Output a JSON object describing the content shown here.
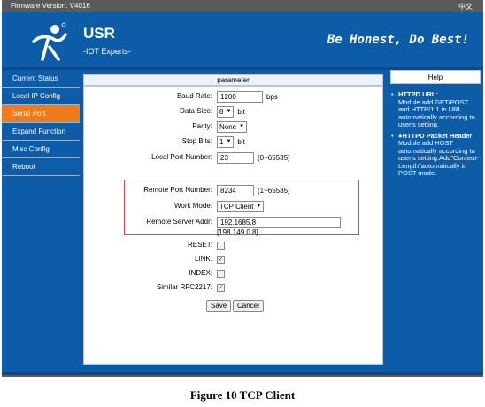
{
  "topbar": {
    "firmware": "Firmware Version: V4016",
    "language": "中文"
  },
  "header": {
    "brand": "USR",
    "brand_sub": "-IOT Experts-",
    "slogan": "Be Honest, Do Best!"
  },
  "sidebar": {
    "items": [
      {
        "label": "Current Status",
        "active": false
      },
      {
        "label": "Local IP Config",
        "active": false
      },
      {
        "label": "Serial Port",
        "active": true
      },
      {
        "label": "Expand Function",
        "active": false
      },
      {
        "label": "Misc Config",
        "active": false
      },
      {
        "label": "Reboot",
        "active": false
      }
    ]
  },
  "main": {
    "heading": "parameter",
    "baud_rate": {
      "label": "Baud Rate:",
      "value": "1200",
      "unit": "bps"
    },
    "data_size": {
      "label": "Data Size:",
      "value": "8",
      "unit": "bit"
    },
    "parity": {
      "label": "Parity:",
      "value": "None"
    },
    "stop_bits": {
      "label": "Stop Bits:",
      "value": "1",
      "unit": "bit"
    },
    "local_port": {
      "label": "Local Port Number:",
      "value": "23",
      "range": "(0~65535)"
    },
    "remote_port": {
      "label": "Remote Port Number:",
      "value": "8234",
      "range": "(1~65535)"
    },
    "work_mode": {
      "label": "Work Mode:",
      "value": "TCP Client"
    },
    "remote_server": {
      "label": "Remote Server Addr:",
      "value": "192.1685.8",
      "resolved": "[198.149.0.8]"
    },
    "reset": {
      "label": "RESET:",
      "checked": false
    },
    "link": {
      "label": "LINK:",
      "checked": true
    },
    "index": {
      "label": "INDEX:",
      "checked": false
    },
    "rfc2217": {
      "label": "Similar RFC2217:",
      "checked": true
    },
    "save_label": "Save",
    "cancel_label": "Cancel"
  },
  "help": {
    "title": "Help",
    "items": [
      {
        "title": "HTTPD URL:",
        "text": "Module add GET/POST and HTTP/1.1 in URL automatically according to user's setting."
      },
      {
        "title": "●HTTPD Packet Header:",
        "text": "Module add HOST automatically according to user's setting.Add\"Content-Length\"automatically in POST mode."
      }
    ]
  },
  "caption": "Figure 10 TCP Client",
  "colors": {
    "brand_blue": "#0d5ca8",
    "active_orange": "#f07b1a",
    "highlight_red": "#d84a4a"
  }
}
